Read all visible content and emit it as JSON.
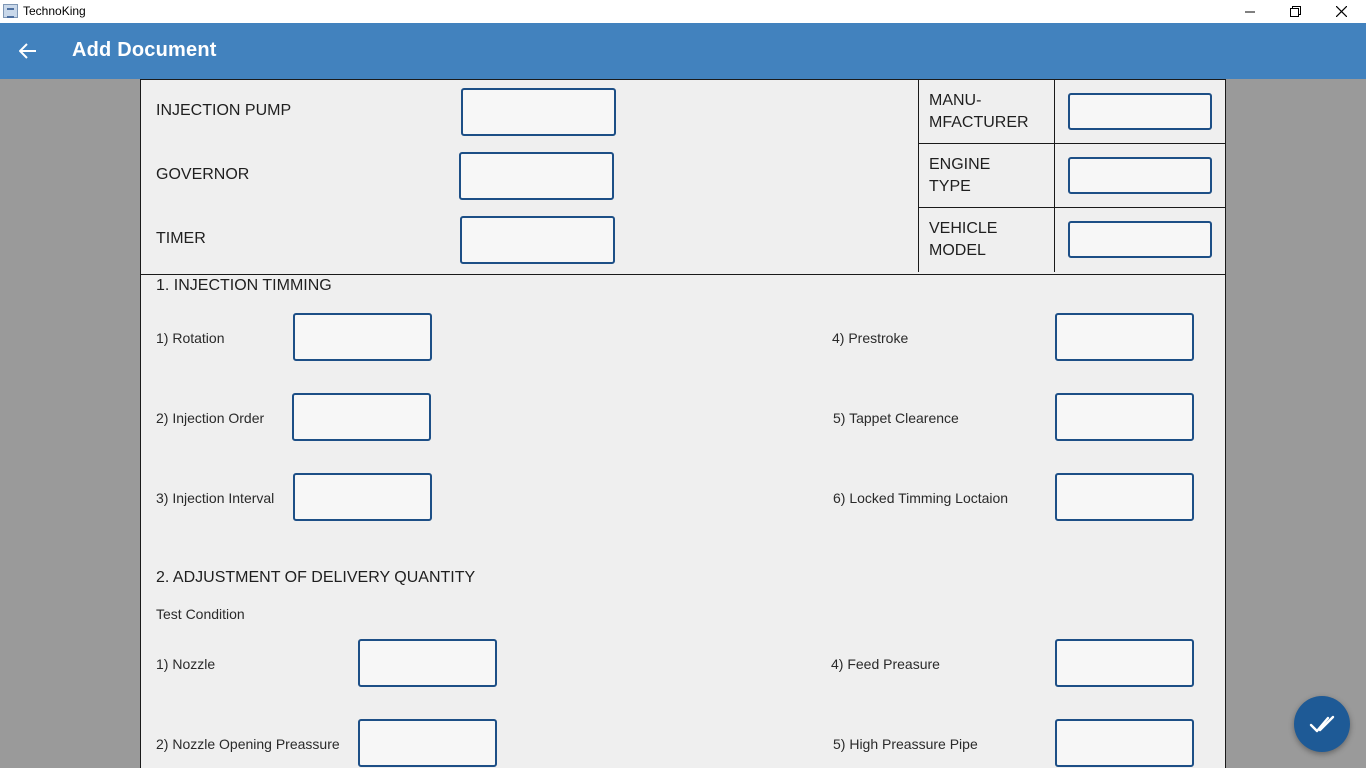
{
  "window": {
    "title": "TechnoKing"
  },
  "appbar": {
    "title": "Add Document"
  },
  "header_fields": {
    "injection_pump": "INJECTION PUMP",
    "governor": "GOVERNOR",
    "timer": "TIMER"
  },
  "header_table": {
    "manufacturer_line1": "MANU-",
    "manufacturer_line2": "MFACTURER",
    "engine_type_line1": "ENGINE",
    "engine_type_line2": "TYPE",
    "vehicle_model_line1": "VEHICLE",
    "vehicle_model_line2": "MODEL"
  },
  "section1": {
    "title": "1. INJECTION TIMMING",
    "left": [
      "1) Rotation",
      "2) Injection Order",
      "3) Injection Interval"
    ],
    "right": [
      "4) Prestroke",
      "5) Tappet Clearence",
      "6) Locked Timming Loctaion"
    ]
  },
  "section2": {
    "title": "2. ADJUSTMENT OF DELIVERY QUANTITY",
    "subtitle": "Test Condition",
    "left": [
      "1) Nozzle",
      "2) Nozzle Opening Preassure"
    ],
    "right": [
      "4) Feed Preasure",
      "5) High Preassure Pipe"
    ]
  },
  "icons": {
    "back": "arrow-left-icon",
    "submit": "check-double-icon"
  },
  "colors": {
    "appbar": "#4282be",
    "input_border": "#1d4f86",
    "fab": "#1e5a96"
  }
}
